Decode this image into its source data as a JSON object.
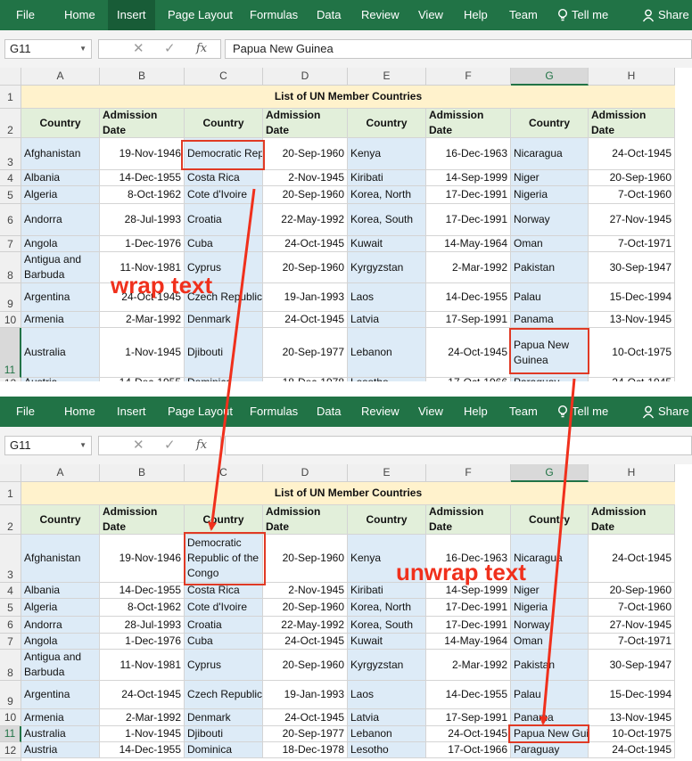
{
  "ribbon": {
    "tabs": [
      "File",
      "Home",
      "Insert",
      "Page Layout",
      "Formulas",
      "Data",
      "Review",
      "View",
      "Help",
      "Team",
      "Tell me",
      "Share"
    ],
    "active_tab": "Insert",
    "color": "#217346"
  },
  "formula_bar": {
    "name_box": "G11",
    "content_top": "Papua New Guinea",
    "content_bottom": ""
  },
  "columns": [
    "A",
    "B",
    "C",
    "D",
    "E",
    "F",
    "G",
    "H"
  ],
  "title": "List of UN Member Countries",
  "headers": [
    "Country",
    "Admission Date",
    "Country",
    "Admission Date",
    "Country",
    "Admission Date",
    "Country",
    "Admission Date"
  ],
  "rows": [
    [
      "Afghanistan",
      "19-Nov-1946",
      "Democratic Republic of the Congo",
      "20-Sep-1960",
      "Kenya",
      "16-Dec-1963",
      "Nicaragua",
      "24-Oct-1945"
    ],
    [
      "Albania",
      "14-Dec-1955",
      "Costa Rica",
      "2-Nov-1945",
      "Kiribati",
      "14-Sep-1999",
      "Niger",
      "20-Sep-1960"
    ],
    [
      "Algeria",
      "8-Oct-1962",
      "Cote d'Ivoire",
      "20-Sep-1960",
      "Korea, North",
      "17-Dec-1991",
      "Nigeria",
      "7-Oct-1960"
    ],
    [
      "Andorra",
      "28-Jul-1993",
      "Croatia",
      "22-May-1992",
      "Korea, South",
      "17-Dec-1991",
      "Norway",
      "27-Nov-1945"
    ],
    [
      "Angola",
      "1-Dec-1976",
      "Cuba",
      "24-Oct-1945",
      "Kuwait",
      "14-May-1964",
      "Oman",
      "7-Oct-1971"
    ],
    [
      "Antigua and Barbuda",
      "11-Nov-1981",
      "Cyprus",
      "20-Sep-1960",
      "Kyrgyzstan",
      "2-Mar-1992",
      "Pakistan",
      "30-Sep-1947"
    ],
    [
      "Argentina",
      "24-Oct-1945",
      "Czech Republic",
      "19-Jan-1993",
      "Laos",
      "14-Dec-1955",
      "Palau",
      "15-Dec-1994"
    ],
    [
      "Armenia",
      "2-Mar-1992",
      "Denmark",
      "24-Oct-1945",
      "Latvia",
      "17-Sep-1991",
      "Panama",
      "13-Nov-1945"
    ],
    [
      "Australia",
      "1-Nov-1945",
      "Djibouti",
      "20-Sep-1977",
      "Lebanon",
      "24-Oct-1945",
      "Papua New Guinea",
      "10-Oct-1975"
    ],
    [
      "Austria",
      "14-Dec-1955",
      "Dominica",
      "18-Dec-1978",
      "Lesotho",
      "17-Oct-1966",
      "Paraguay",
      "24-Oct-1945"
    ]
  ],
  "annotations": {
    "wrap": "wrap text",
    "unwrap": "unwrap text"
  },
  "colors": {
    "annotation": "#f0301c",
    "header_fill": "#e2efda",
    "country_fill": "#ddebf7",
    "title_fill": "#fff2cc"
  }
}
